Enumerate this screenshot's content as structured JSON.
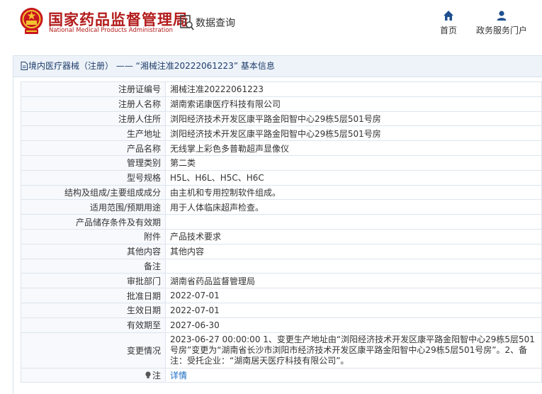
{
  "header": {
    "title": "国家药品监督管理局",
    "subtitle": "National Medical Products Administration",
    "query_link": "数据查询",
    "nav": [
      {
        "label": "首页",
        "icon": "home-icon"
      },
      {
        "label": "政务服务门户",
        "icon": "user-icon"
      }
    ]
  },
  "panel": {
    "title": "境内医疗器械（注册） —— “湘械注准20222061223” 基本信息"
  },
  "records": [
    {
      "label": "注册证编号",
      "value": "湘械注准20222061223"
    },
    {
      "label": "注册人名称",
      "value": "湖南索诺康医疗科技有限公司"
    },
    {
      "label": "注册人住所",
      "value": "浏阳经济技术开发区康平路金阳智中心29栋5层501号房"
    },
    {
      "label": "生产地址",
      "value": "浏阳经济技术开发区康平路金阳智中心29栋5层501号房"
    },
    {
      "label": "产品名称",
      "value": "无线掌上彩色多普勒超声显像仪"
    },
    {
      "label": "管理类别",
      "value": "第二类"
    },
    {
      "label": "型号规格",
      "value": "H5L、H6L、H5C、H6C"
    },
    {
      "label": "结构及组成/主要组成成分",
      "value": "由主机和专用控制软件组成。"
    },
    {
      "label": "适用范围/预期用途",
      "value": "用于人体临床超声检查。"
    },
    {
      "label": "产品储存条件及有效期",
      "value": ""
    },
    {
      "label": "附件",
      "value": "产品技术要求"
    },
    {
      "label": "其他内容",
      "value": "其他内容"
    },
    {
      "label": "备注",
      "value": ""
    },
    {
      "label": "审批部门",
      "value": "湖南省药品监督管理局"
    },
    {
      "label": "批准日期",
      "value": "2022-07-01"
    },
    {
      "label": "生效日期",
      "value": "2022-07-01"
    },
    {
      "label": "有效期至",
      "value": "2027-06-30"
    },
    {
      "label": "变更情况",
      "value": "2023-06-27 00:00:00 1、变更生产地址由“浏阳经济技术开发区康平路金阳智中心29栋5层501号房”变更为“湖南省长沙市浏阳市经济技术开发区康平路金阳智中心29栋5层501号房”。2、备注：受托企业：“湖南居天医疗科技有限公司”。"
    },
    {
      "label": "注",
      "value": "详情",
      "icon": "lightbulb-icon"
    }
  ],
  "colors": {
    "brand_red": "#b31b1b",
    "link_blue": "#1a6bc4",
    "panel_header_bg": "#edf3f9"
  }
}
